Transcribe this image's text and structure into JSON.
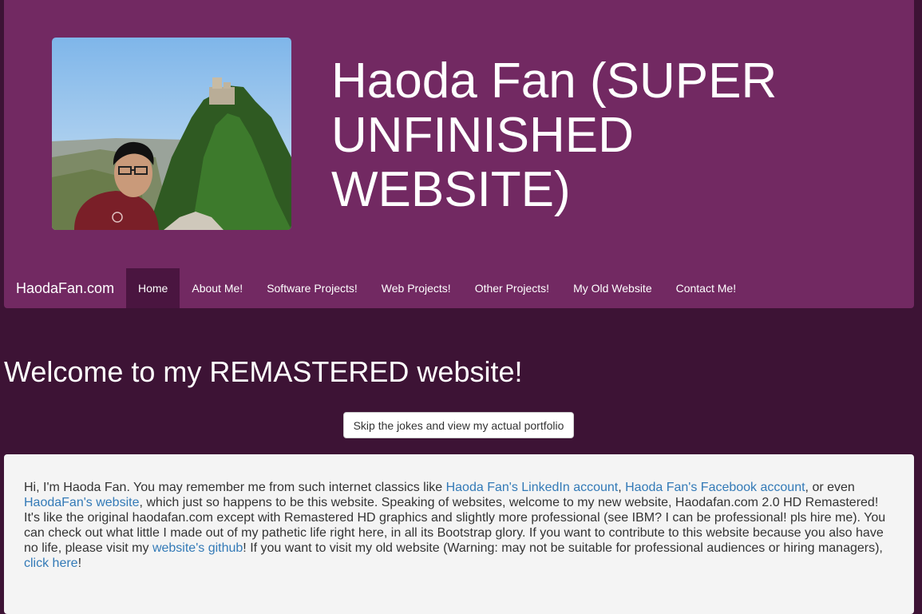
{
  "header": {
    "title": "Haoda Fan (SUPER UNFINISHED WEBSITE)"
  },
  "navbar": {
    "brand": "HaodaFan.com",
    "items": [
      {
        "label": "Home",
        "active": true
      },
      {
        "label": "About Me!",
        "active": false
      },
      {
        "label": "Software Projects!",
        "active": false
      },
      {
        "label": "Web Projects!",
        "active": false
      },
      {
        "label": "Other Projects!",
        "active": false
      },
      {
        "label": "My Old Website",
        "active": false
      },
      {
        "label": "Contact Me!",
        "active": false
      }
    ]
  },
  "main": {
    "heading": "Welcome to my REMASTERED website!",
    "skip_button": "Skip the jokes and view my actual portfolio",
    "intro": {
      "t1": "Hi, I'm Haoda Fan. You may remember me from such internet classics like ",
      "link1": "Haoda Fan's LinkedIn account",
      "t2": ", ",
      "link2": "Haoda Fan's Facebook account",
      "t3": ", or even ",
      "link3": "HaodaFan's website",
      "t4": ", which just so happens to be this website. Speaking of websites, welcome to my new website, Haodafan.com 2.0 HD Remastered! It's like the original haodafan.com except with Remastered HD graphics and slightly more professional (see IBM? I can be professional! pls hire me). You can check out what little I made out of my pathetic life right here, in all its Bootstrap glory. If you want to contribute to this website because you also have no life, please visit my ",
      "link4": "website's github",
      "t5": "! If you want to visit my old website (Warning: may not be suitable for professional audiences or hiring managers), ",
      "link5": "click here",
      "t6": "!"
    }
  },
  "colors": {
    "page_background": "#3d1335",
    "header_background": "#722962",
    "nav_active": "#4a1540",
    "panel_background": "#f4f4f4",
    "link": "#337ab7"
  }
}
